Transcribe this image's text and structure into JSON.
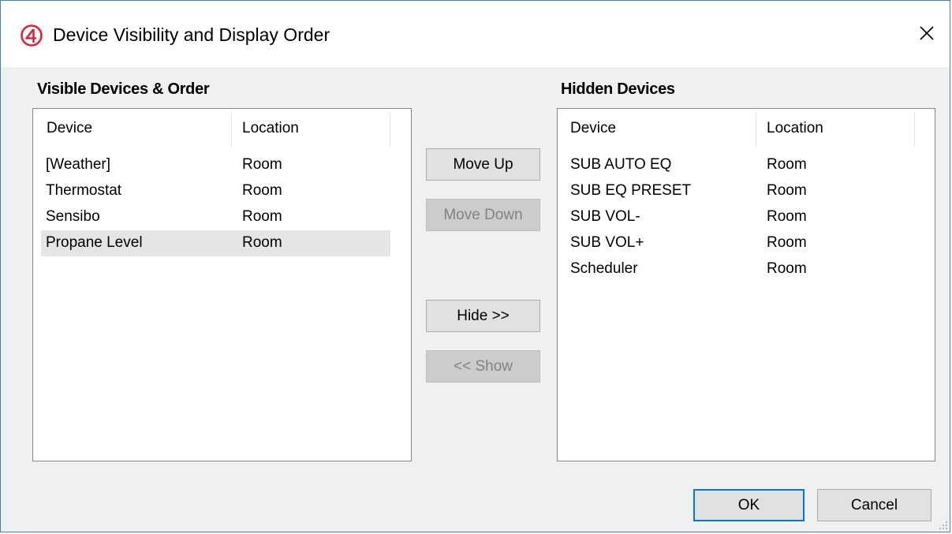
{
  "window": {
    "title": "Device Visibility and Display Order",
    "close_glyph": "✕",
    "accent_color": "#d7263d"
  },
  "visible_panel": {
    "label": "Visible Devices & Order",
    "columns": [
      "Device",
      "Location"
    ],
    "rows": [
      {
        "device": "[Weather]",
        "location": "Room"
      },
      {
        "device": "Thermostat",
        "location": "Room"
      },
      {
        "device": "Sensibo",
        "location": "Room"
      },
      {
        "device": "Propane Level",
        "location": "Room",
        "selected": true
      }
    ]
  },
  "hidden_panel": {
    "label": "Hidden Devices",
    "columns": [
      "Device",
      "Location"
    ],
    "rows": [
      {
        "device": "SUB AUTO EQ",
        "location": "Room"
      },
      {
        "device": "SUB EQ PRESET",
        "location": "Room"
      },
      {
        "device": "SUB VOL-",
        "location": "Room"
      },
      {
        "device": "SUB VOL+",
        "location": "Room"
      },
      {
        "device": "Scheduler",
        "location": "Room"
      }
    ]
  },
  "buttons": {
    "move_up": "Move Up",
    "move_down": "Move Down",
    "hide": "Hide >>",
    "show": "<< Show",
    "ok": "OK",
    "cancel": "Cancel"
  }
}
